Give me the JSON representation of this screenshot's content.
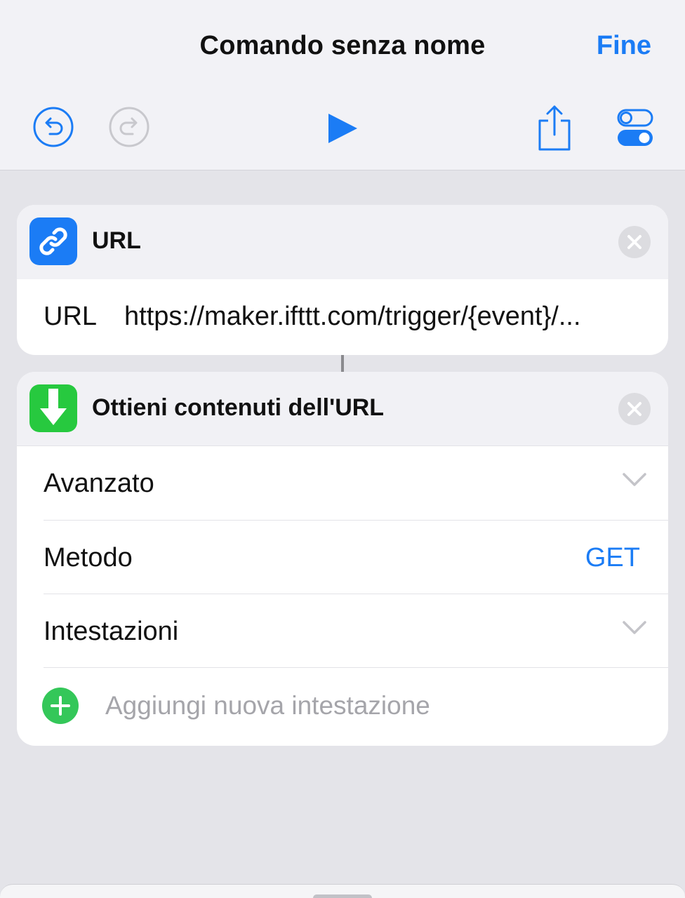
{
  "header": {
    "title": "Comando senza nome",
    "done_label": "Fine"
  },
  "toolbar": {
    "icons": [
      "undo-icon",
      "redo-icon",
      "play-icon",
      "share-icon",
      "settings-toggle-icon"
    ]
  },
  "actions": [
    {
      "title": "URL",
      "icon": "link-icon",
      "icon_color": "#1b7cf5",
      "field_label": "URL",
      "field_value": "https://maker.ifttt.com/trigger/{event}/..."
    },
    {
      "title": "Ottieni contenuti dell'URL",
      "icon": "download-arrow-icon",
      "icon_color": "#27c93f",
      "rows": [
        {
          "label": "Avanzato"
        },
        {
          "label": "Metodo",
          "value": "GET"
        },
        {
          "label": "Intestazioni"
        }
      ],
      "add_label": "Aggiungi nuova intestazione"
    }
  ],
  "colors": {
    "accent": "#1b7cf5",
    "add_green": "#34c759"
  }
}
